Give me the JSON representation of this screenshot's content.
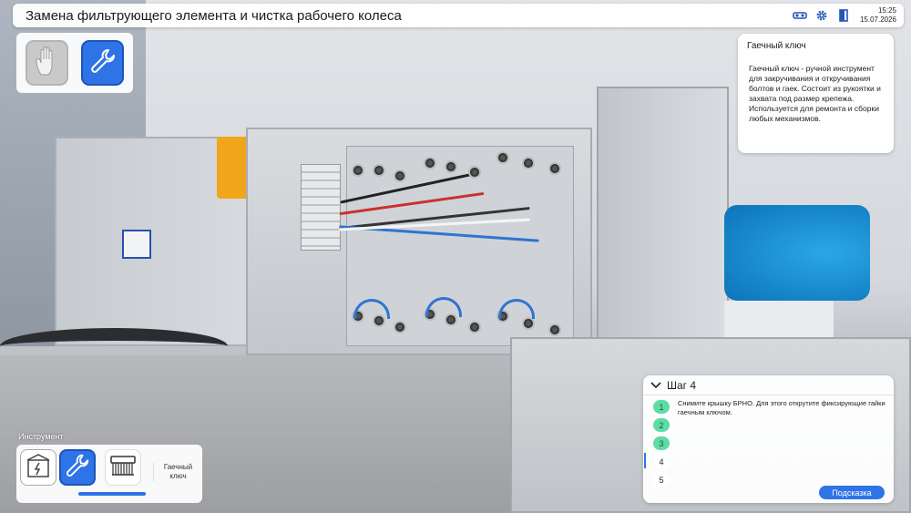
{
  "header": {
    "title": "Замена фильтрующего элемента и чистка рабочего колеса",
    "time": "15:25",
    "date": "15.07.2026",
    "icons": [
      "vr-glasses-icon",
      "gear-icon",
      "exit-door-icon"
    ]
  },
  "modes": [
    {
      "name": "hand-mode",
      "icon": "hand-icon",
      "active": false
    },
    {
      "name": "tool-mode",
      "icon": "wrench-icon",
      "active": true
    }
  ],
  "info_card": {
    "title": "Гаечный ключ",
    "text": "Гаечный ключ - ручной инструмент для закручивания и откручивания болтов и гаек. Состоит из рукоятки и захвата под размер крепежа. Используется для ремонта и сборки любых механизмов."
  },
  "tools": {
    "label": "Инструмент",
    "items": [
      {
        "icon": "panel-icon"
      },
      {
        "icon": "wrench-icon",
        "selected": true
      },
      {
        "icon": "brush-icon"
      }
    ],
    "selected_name": "Гаечный ключ"
  },
  "steps": {
    "title": "Шаг 4",
    "numbers": [
      "1",
      "2",
      "3",
      "4",
      "5"
    ],
    "statuses": [
      "done",
      "done",
      "done",
      "current",
      "todo"
    ],
    "current_text": "Снимите крышку БРНО. Для этого открутите фиксирующие гайки гаечным ключом.",
    "hint_label": "Подсказка"
  },
  "colors": {
    "accent": "#2f74e6",
    "done": "#5fdba4",
    "motor": "#1a8fd6",
    "actuator": "#f1a51b"
  }
}
